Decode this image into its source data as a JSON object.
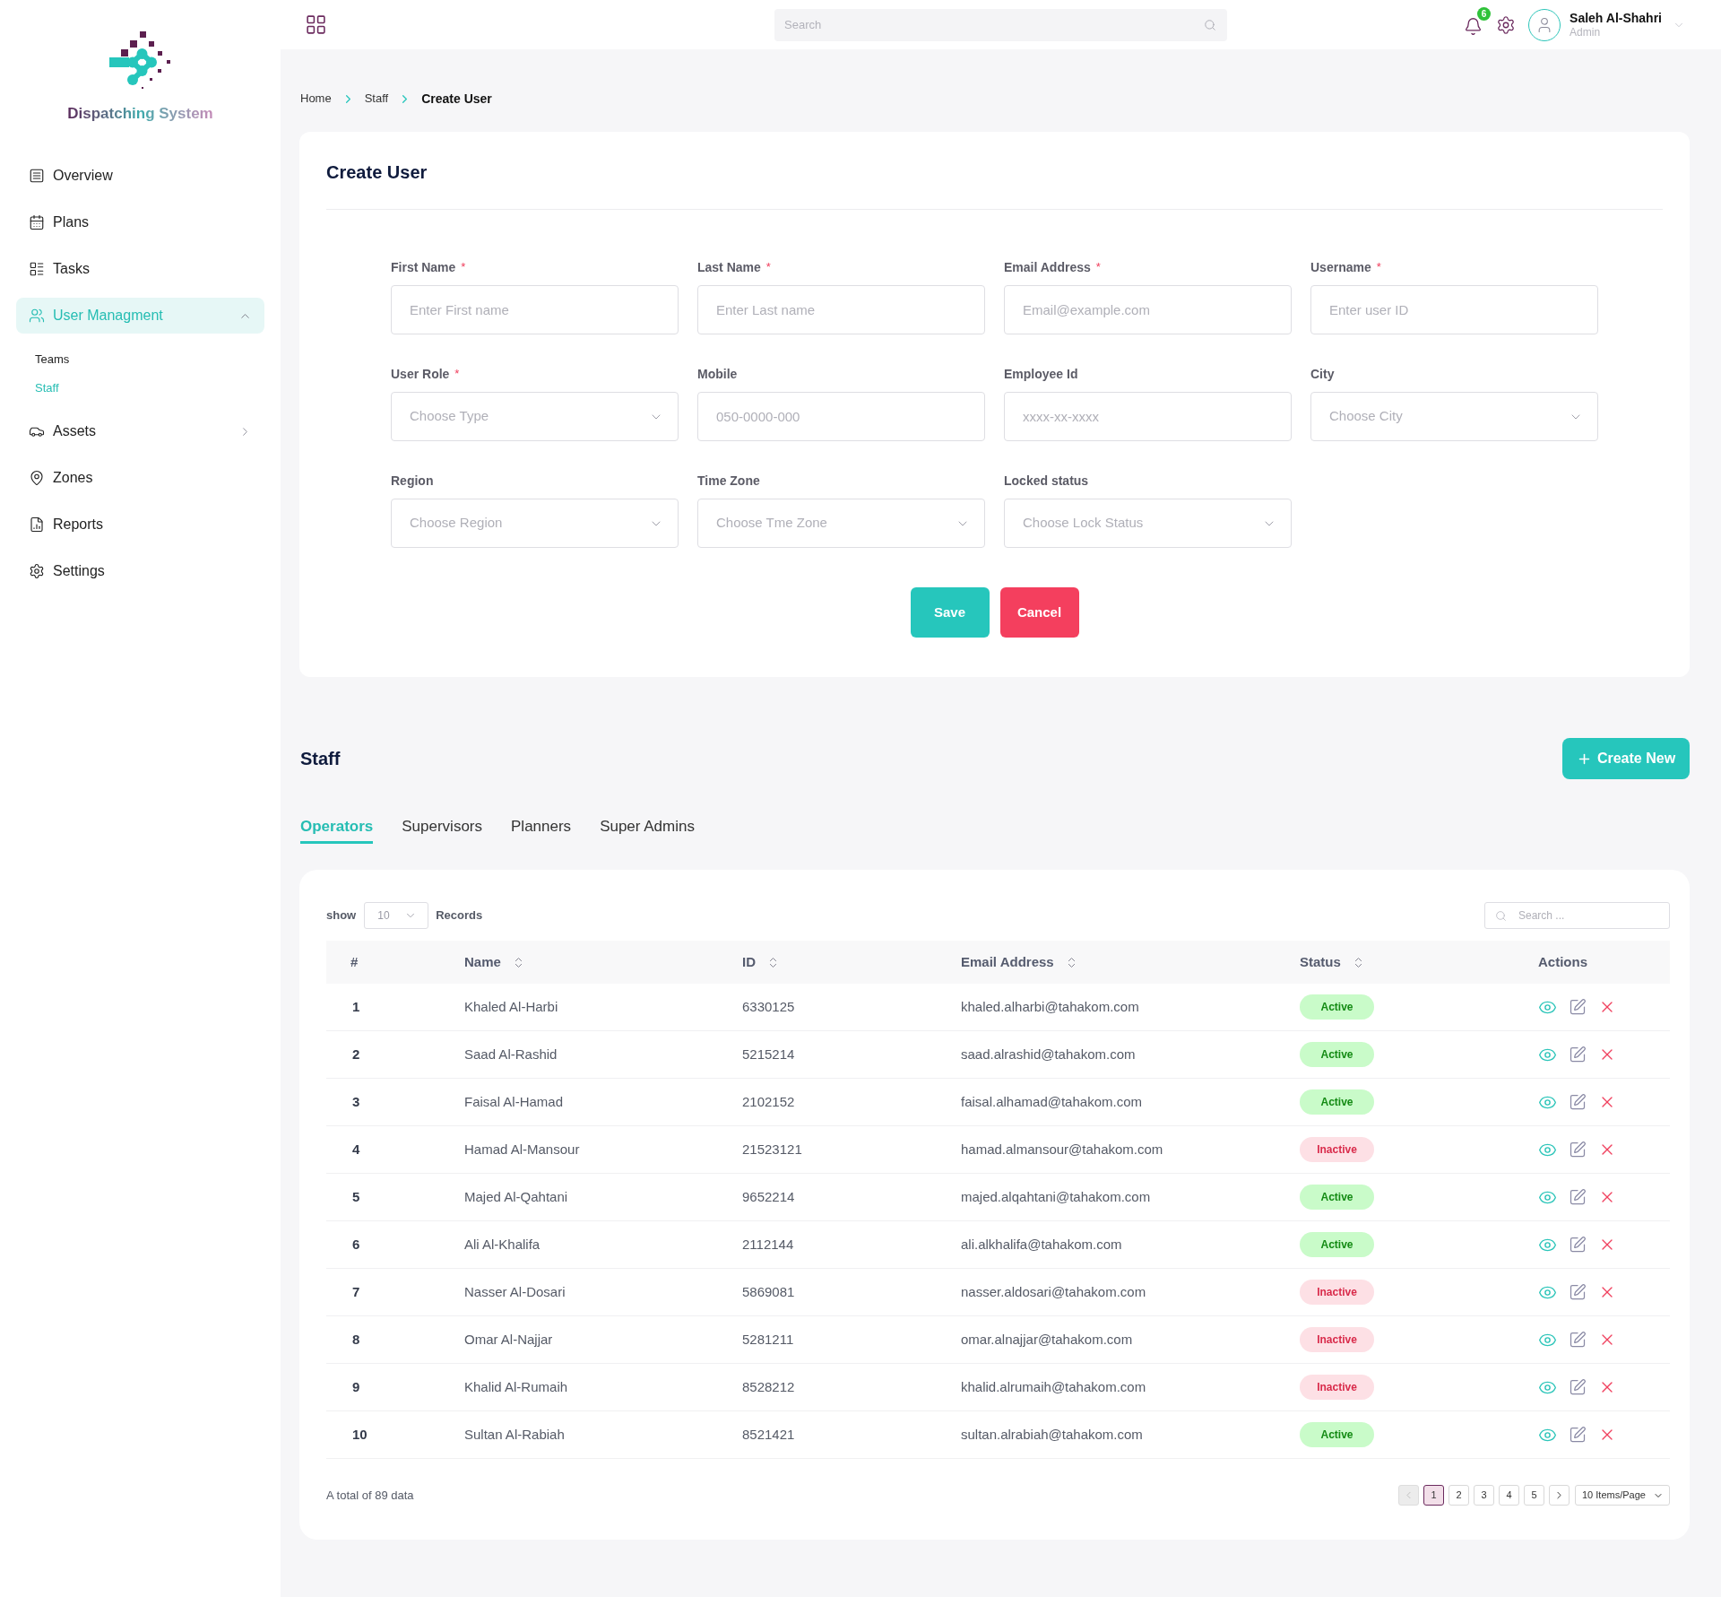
{
  "sidebar": {
    "logo_text": "Dispatching System",
    "items": [
      {
        "label": "Overview",
        "selected": false
      },
      {
        "label": "Plans",
        "selected": false
      },
      {
        "label": "Tasks",
        "selected": false
      },
      {
        "label": "User Managment",
        "selected": true,
        "expanded": true,
        "children": [
          {
            "label": "Teams",
            "selected": false
          },
          {
            "label": "Staff",
            "selected": true
          }
        ]
      },
      {
        "label": "Assets",
        "selected": false,
        "expanded": false
      },
      {
        "label": "Zones",
        "selected": false
      },
      {
        "label": "Reports",
        "selected": false
      },
      {
        "label": "Settings",
        "selected": false
      }
    ]
  },
  "top_bar": {
    "search": {
      "placeholder": "Search"
    },
    "notifications": {
      "count": "6"
    },
    "user": {
      "name": "Saleh Al-Shahri",
      "role": "Admin"
    }
  },
  "breadcrumb": [
    "Home",
    "Staff",
    "Create User"
  ],
  "create_user": {
    "title": "Create User",
    "required_mark": "*",
    "fields": [
      {
        "label": "First Name",
        "required": true,
        "kind": "input",
        "placeholder": "Enter First name"
      },
      {
        "label": "Last Name",
        "required": true,
        "kind": "input",
        "placeholder": "Enter Last name"
      },
      {
        "label": "Email Address",
        "required": true,
        "kind": "input",
        "placeholder": "Email@example.com"
      },
      {
        "label": "Username",
        "required": true,
        "kind": "input",
        "placeholder": "Enter user ID"
      },
      {
        "label": "User Role",
        "required": true,
        "kind": "select",
        "placeholder": "Choose Type"
      },
      {
        "label": "Mobile",
        "required": false,
        "kind": "input",
        "placeholder": "050-0000-000"
      },
      {
        "label": "Employee Id",
        "required": false,
        "kind": "input",
        "placeholder": "xxxx-xx-xxxx"
      },
      {
        "label": "City",
        "required": false,
        "kind": "select",
        "placeholder": "Choose City"
      },
      {
        "label": "Region",
        "required": false,
        "kind": "select",
        "placeholder": "Choose Region"
      },
      {
        "label": "Time Zone",
        "required": false,
        "kind": "select",
        "placeholder": "Choose Tme Zone"
      },
      {
        "label": "Locked status",
        "required": false,
        "kind": "select",
        "placeholder": "Choose Lock Status"
      }
    ],
    "buttons": [
      {
        "label": "Save",
        "kind": "primary"
      },
      {
        "label": "Cancel",
        "kind": "danger"
      }
    ]
  },
  "staff": {
    "title": "Staff",
    "create_button": {
      "label": "Create New"
    },
    "tabs": [
      {
        "label": "Operators",
        "selected": true
      },
      {
        "label": "Supervisors",
        "selected": false
      },
      {
        "label": "Planners",
        "selected": false
      },
      {
        "label": "Super Admins",
        "selected": false
      }
    ],
    "table": {
      "show_label": "show",
      "page_size": "10",
      "records_label": "Records",
      "search": {
        "placeholder": "Search ..."
      },
      "columns": [
        {
          "label": "#",
          "sortable": false
        },
        {
          "label": "Name",
          "sortable": true
        },
        {
          "label": "ID",
          "sortable": true
        },
        {
          "label": "Email Address",
          "sortable": true
        },
        {
          "label": "Status",
          "sortable": true
        },
        {
          "label": "Actions",
          "sortable": false
        }
      ],
      "rows": [
        {
          "cells": [
            "1",
            "Khaled Al-Harbi",
            "6330125",
            "khaled.alharbi@tahakom.com"
          ],
          "status": {
            "label": "Active",
            "kind": "active"
          }
        },
        {
          "cells": [
            "2",
            "Saad Al-Rashid",
            "5215214",
            "saad.alrashid@tahakom.com"
          ],
          "status": {
            "label": "Active",
            "kind": "active"
          }
        },
        {
          "cells": [
            "3",
            "Faisal Al-Hamad",
            "2102152",
            "faisal.alhamad@tahakom.com"
          ],
          "status": {
            "label": "Active",
            "kind": "active"
          }
        },
        {
          "cells": [
            "4",
            "Hamad Al-Mansour",
            "21523121",
            "hamad.almansour@tahakom.com"
          ],
          "status": {
            "label": "Inactive",
            "kind": "inactive"
          }
        },
        {
          "cells": [
            "5",
            "Majed Al-Qahtani",
            "9652214",
            "majed.alqahtani@tahakom.com"
          ],
          "status": {
            "label": "Active",
            "kind": "active"
          }
        },
        {
          "cells": [
            "6",
            "Ali Al-Khalifa",
            "2112144",
            "ali.alkhalifa@tahakom.com"
          ],
          "status": {
            "label": "Active",
            "kind": "active"
          }
        },
        {
          "cells": [
            "7",
            "Nasser Al-Dosari",
            "5869081",
            "nasser.aldosari@tahakom.com"
          ],
          "status": {
            "label": "Inactive",
            "kind": "inactive"
          }
        },
        {
          "cells": [
            "8",
            "Omar Al-Najjar",
            "5281211",
            "omar.alnajjar@tahakom.com"
          ],
          "status": {
            "label": "Inactive",
            "kind": "inactive"
          }
        },
        {
          "cells": [
            "9",
            "Khalid Al-Rumaih",
            "8528212",
            "khalid.alrumaih@tahakom.com"
          ],
          "status": {
            "label": "Inactive",
            "kind": "inactive"
          }
        },
        {
          "cells": [
            "10",
            "Sultan Al-Rabiah",
            "8521421",
            "sultan.alrabiah@tahakom.com"
          ],
          "status": {
            "label": "Active",
            "kind": "active"
          }
        }
      ],
      "footer": {
        "total": "A total of 89 data",
        "previous": {
          "disabled": true
        },
        "pages": [
          {
            "label": "1",
            "selected": true
          },
          {
            "label": "2",
            "selected": false
          },
          {
            "label": "3",
            "selected": false
          },
          {
            "label": "4",
            "selected": false
          },
          {
            "label": "5",
            "selected": false
          }
        ],
        "next": {
          "disabled": false
        },
        "items_per_page": "10 Items/Page"
      }
    }
  }
}
